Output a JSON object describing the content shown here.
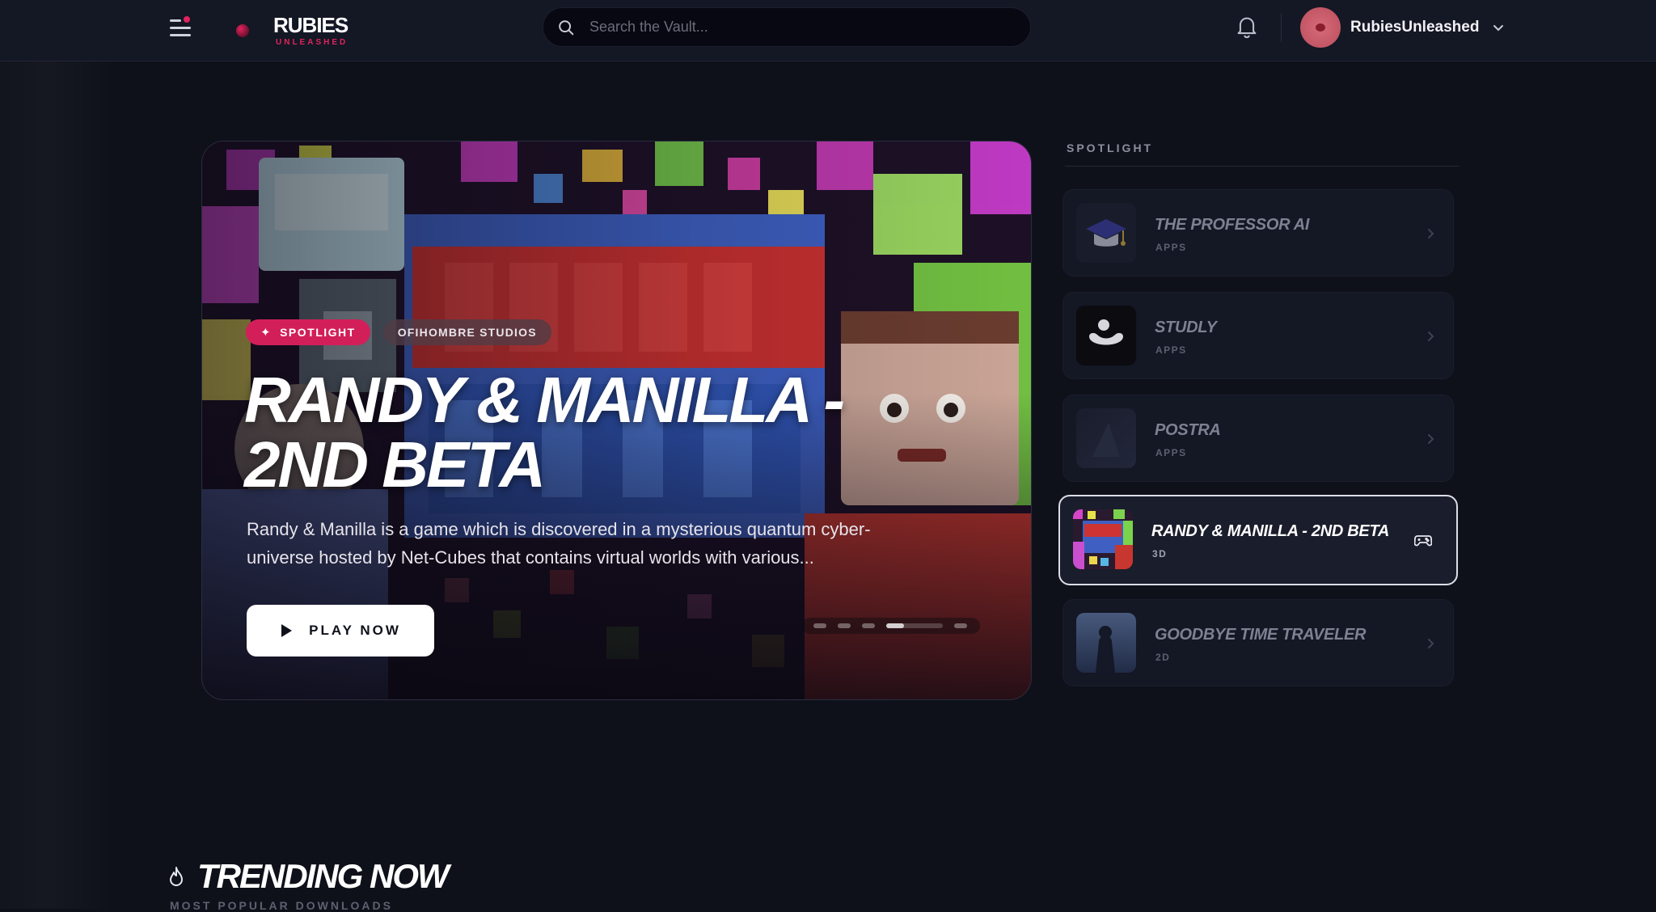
{
  "brand": {
    "name": "RUBIES",
    "tagline": "UNLEASHED",
    "accent": "#e0245e"
  },
  "header": {
    "search_placeholder": "Search the Vault...",
    "username": "RubiesUnleashed",
    "icons": [
      "menu-icon",
      "search-icon",
      "bell-icon",
      "chevron-down-icon"
    ]
  },
  "hero": {
    "badge": "SPOTLIGHT",
    "studio": "OFIHOMBRE STUDIOS",
    "title": "RANDY & MANILLA - 2ND BETA",
    "description": "Randy & Manilla is a game which is discovered in a mysterious quantum cyber-universe hosted by Net-Cubes that contains virtual worlds with various...",
    "play_label": "PLAY NOW",
    "slide_count": 6,
    "active_slide": 4
  },
  "spotlight": {
    "heading": "SPOTLIGHT",
    "items": [
      {
        "title": "THE PROFESSOR AI",
        "category": "APPS",
        "icon": "graduation-cap-icon",
        "active": false
      },
      {
        "title": "STUDLY",
        "category": "APPS",
        "icon": "studly-logo-icon",
        "active": false
      },
      {
        "title": "POSTRA",
        "category": "APPS",
        "icon": "postra-thumbnail",
        "active": false
      },
      {
        "title": "RANDY & MANILLA - 2ND BETA",
        "category": "3D",
        "icon": "gamepad-icon",
        "active": true
      },
      {
        "title": "GOODBYE TIME TRAVELER",
        "category": "2D",
        "icon": "time-traveler-thumbnail",
        "active": false
      }
    ]
  },
  "trending": {
    "title": "TRENDING NOW",
    "subtitle": "MOST POPULAR DOWNLOADS"
  }
}
